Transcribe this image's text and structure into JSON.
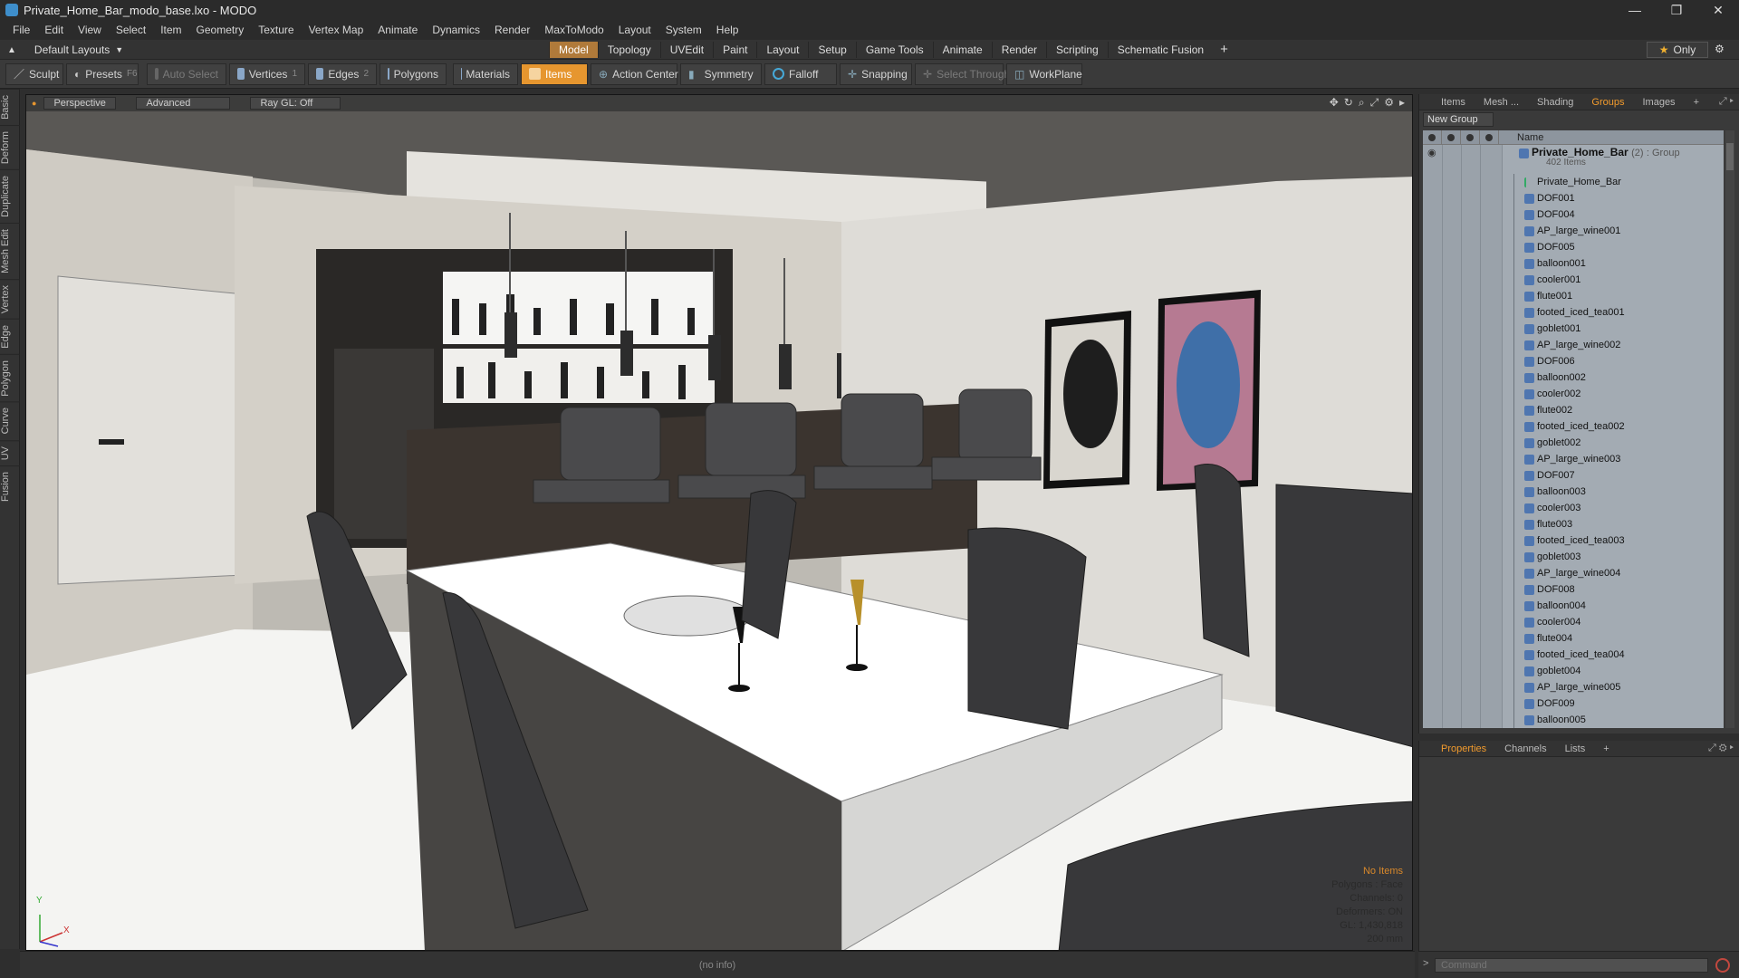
{
  "window": {
    "title": "Private_Home_Bar_modo_base.lxo - MODO",
    "controls": [
      "—",
      "❐",
      "✕"
    ]
  },
  "menu": [
    "File",
    "Edit",
    "View",
    "Select",
    "Item",
    "Geometry",
    "Texture",
    "Vertex Map",
    "Animate",
    "Dynamics",
    "Render",
    "MaxToModo",
    "Layout",
    "System",
    "Help"
  ],
  "layout": {
    "current": "Default Layouts",
    "tabs": [
      "Model",
      "Topology",
      "UVEdit",
      "Paint",
      "Layout",
      "Setup",
      "Game Tools",
      "Animate",
      "Render",
      "Scripting",
      "Schematic Fusion"
    ],
    "active_tab": "Model",
    "only_label": "Only"
  },
  "toolbar": {
    "sculpt": "Sculpt",
    "presets": "Presets",
    "presets_key": "F6",
    "auto_select": "Auto Select",
    "vertices": "Vertices",
    "vertices_key": "1",
    "edges": "Edges",
    "edges_key": "2",
    "polygons": "Polygons",
    "materials": "Materials",
    "items": "Items",
    "action_center": "Action Center",
    "symmetry": "Symmetry",
    "falloff": "Falloff",
    "snapping": "Snapping",
    "select_through": "Select Through",
    "workplane": "WorkPlane"
  },
  "left_tabs": [
    "Basic",
    "Deform",
    "Duplicate",
    "Mesh Edit",
    "Vertex",
    "Edge",
    "Polygon",
    "Curve",
    "UV",
    "Fusion"
  ],
  "viewport": {
    "view": "Perspective",
    "shading": "Advanced",
    "raygl": "Ray GL: Off",
    "hud": {
      "selection": "No Items",
      "polygons": "Polygons : Face",
      "channels": "Channels: 0",
      "deformers": "Deformers: ON",
      "gl": "GL: 1,430,818",
      "scale": "200 mm"
    },
    "axis": {
      "y": "Y",
      "x": "X"
    }
  },
  "groups_panel": {
    "tabs": [
      "Items",
      "Mesh ...",
      "Shading",
      "Groups",
      "Images"
    ],
    "active_tab": "Groups",
    "new_group": "New Group",
    "name_header": "Name",
    "root": {
      "name": "Private_Home_Bar",
      "count": "(2)",
      "type": ": Group",
      "sub": "402 Items"
    },
    "items": [
      "Private_Home_Bar",
      "DOF001",
      "DOF004",
      "AP_large_wine001",
      "DOF005",
      "balloon001",
      "cooler001",
      "flute001",
      "footed_iced_tea001",
      "goblet001",
      "AP_large_wine002",
      "DOF006",
      "balloon002",
      "cooler002",
      "flute002",
      "footed_iced_tea002",
      "goblet002",
      "AP_large_wine003",
      "DOF007",
      "balloon003",
      "cooler003",
      "flute003",
      "footed_iced_tea003",
      "goblet003",
      "AP_large_wine004",
      "DOF008",
      "balloon004",
      "cooler004",
      "flute004",
      "footed_iced_tea004",
      "goblet004",
      "AP_large_wine005",
      "DOF009",
      "balloon005"
    ]
  },
  "properties_panel": {
    "tabs": [
      "Properties",
      "Channels",
      "Lists"
    ],
    "active_tab": "Properties"
  },
  "status": {
    "info": "(no info)"
  },
  "command": {
    "placeholder": "Command"
  },
  "colors": {
    "accent": "#e6962f",
    "active_tab": "#f29b2d",
    "group_bg": "#a3abb3"
  }
}
